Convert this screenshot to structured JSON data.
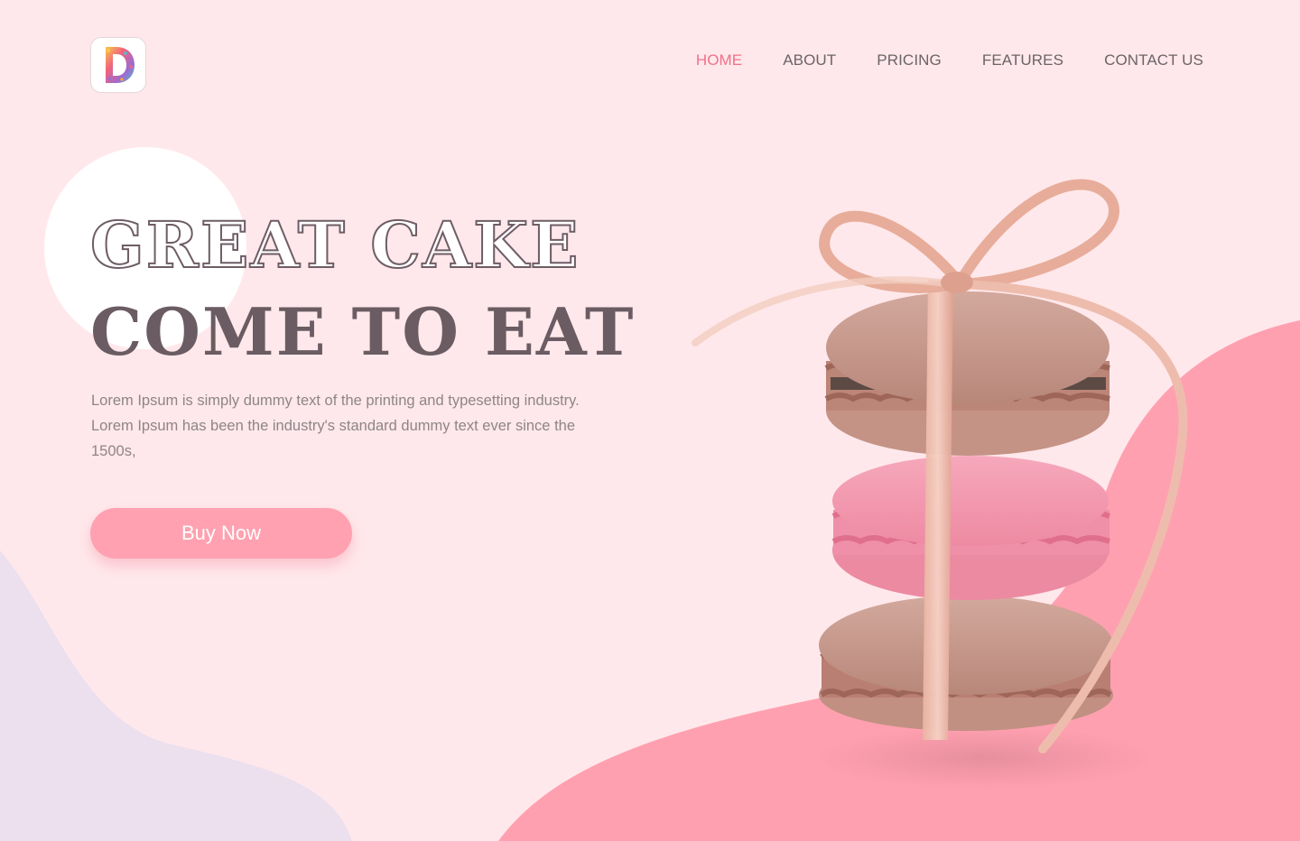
{
  "header": {
    "logo_icon": "sprinkle-d-logo-icon",
    "nav": [
      {
        "label": "HOME",
        "active": true
      },
      {
        "label": "ABOUT",
        "active": false
      },
      {
        "label": "PRICING",
        "active": false
      },
      {
        "label": "FEATURES",
        "active": false
      },
      {
        "label": "CONTACT US",
        "active": false
      }
    ]
  },
  "hero": {
    "headline_outline": "GREAT CAKE",
    "headline_solid": "COME TO EAT",
    "description": "Lorem Ipsum is simply dummy text of the printing and typesetting industry. Lorem Ipsum has been the industry's standard dummy text ever since the 1500s,",
    "cta_label": "Buy Now",
    "image": "macaron-stack-with-ribbon"
  },
  "colors": {
    "background": "#ffe8eb",
    "accent": "#f0708a",
    "button": "#ffa1b0",
    "blob_pink": "#ffa0b0",
    "blob_lavender": "#ecdfee",
    "headline": "#6b5c63"
  }
}
